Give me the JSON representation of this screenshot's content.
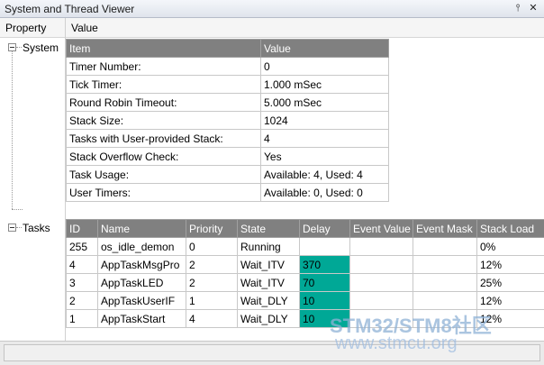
{
  "window": {
    "title": "System and Thread Viewer",
    "pin_icon": "pin-icon",
    "close_icon": "close-icon"
  },
  "headers": {
    "property": "Property",
    "value": "Value"
  },
  "tree": {
    "system": "System",
    "tasks": "Tasks"
  },
  "system_table": {
    "columns": [
      "Item",
      "Value"
    ],
    "rows": [
      [
        "Timer Number:",
        "0"
      ],
      [
        "Tick Timer:",
        "1.000 mSec"
      ],
      [
        "Round Robin Timeout:",
        "5.000 mSec"
      ],
      [
        "Stack Size:",
        "1024"
      ],
      [
        "Tasks with User-provided Stack:",
        "4"
      ],
      [
        "Stack Overflow Check:",
        "Yes"
      ],
      [
        "Task Usage:",
        "Available: 4, Used: 4"
      ],
      [
        "User Timers:",
        "Available: 0, Used: 0"
      ]
    ]
  },
  "tasks_table": {
    "columns": [
      "ID",
      "Name",
      "Priority",
      "State",
      "Delay",
      "Event Value",
      "Event Mask",
      "Stack Load"
    ],
    "rows": [
      [
        "255",
        "os_idle_demon",
        "0",
        "Running",
        "",
        "",
        "",
        "0%"
      ],
      [
        "4",
        "AppTaskMsgPro",
        "2",
        "Wait_ITV",
        "370",
        "",
        "",
        "12%"
      ],
      [
        "3",
        "AppTaskLED",
        "2",
        "Wait_ITV",
        "70",
        "",
        "",
        "25%"
      ],
      [
        "2",
        "AppTaskUserIF",
        "1",
        "Wait_DLY",
        "10",
        "",
        "",
        "12%"
      ],
      [
        "1",
        "AppTaskStart",
        "4",
        "Wait_DLY",
        "10",
        "",
        "",
        "12%"
      ]
    ],
    "highlight_color": "#00a896"
  },
  "watermark": {
    "line1": "STM32/STM8社区",
    "line2": "www.stmcu.org"
  }
}
